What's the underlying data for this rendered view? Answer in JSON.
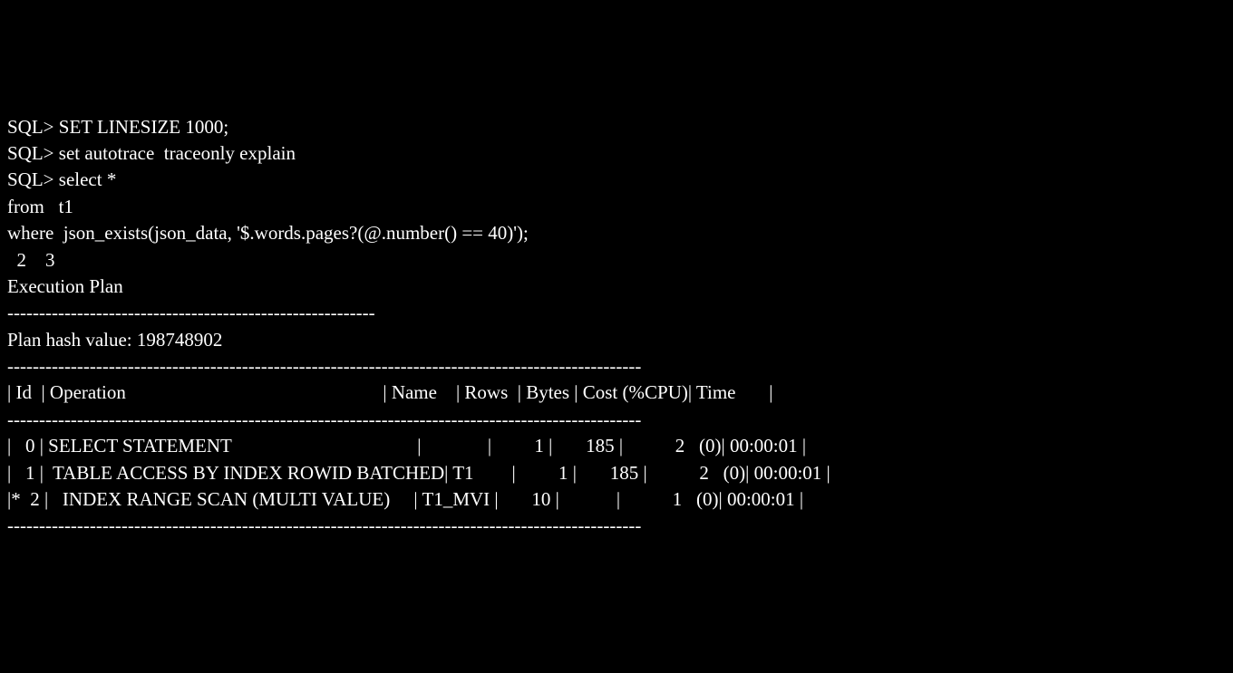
{
  "terminal": {
    "lines": [
      "SQL> SET LINESIZE 1000;",
      "SQL> set autotrace  traceonly explain",
      "SQL> select *",
      "from   t1",
      "where  json_exists(json_data, '$.words.pages?(@.number() == 40)');",
      "  2    3  ",
      "Execution Plan",
      "----------------------------------------------------------",
      "Plan hash value: 198748902",
      "",
      "----------------------------------------------------------------------------------------------------",
      "| Id  | Operation                                                      | Name    | Rows  | Bytes | Cost (%CPU)| Time       |",
      "----------------------------------------------------------------------------------------------------",
      "|   0 | SELECT STATEMENT                                       |              |         1 |       185 |           2   (0)| 00:00:01 |",
      "|   1 |  TABLE ACCESS BY INDEX ROWID BATCHED| T1        |         1 |       185 |           2   (0)| 00:00:01 |",
      "|*  2 |   INDEX RANGE SCAN (MULTI VALUE)     | T1_MVI |       10 |            |           1   (0)| 00:00:01 |",
      "",
      "----------------------------------------------------------------------------------------------------"
    ]
  },
  "execution_plan": {
    "plan_hash_value": "198748902",
    "rows": [
      {
        "id": "0",
        "operation": "SELECT STATEMENT",
        "name": "",
        "rows": "1",
        "bytes": "185",
        "cost_cpu": "2   (0)",
        "time": "00:00:01"
      },
      {
        "id": "1",
        "operation": "TABLE ACCESS BY INDEX ROWID BATCHED",
        "name": "T1",
        "rows": "1",
        "bytes": "185",
        "cost_cpu": "2   (0)",
        "time": "00:00:01"
      },
      {
        "id": "*  2",
        "operation": "INDEX RANGE SCAN (MULTI VALUE)",
        "name": "T1_MVI",
        "rows": "10",
        "bytes": "",
        "cost_cpu": "1   (0)",
        "time": "00:00:01"
      }
    ]
  },
  "sql_commands": {
    "cmd1": "SET LINESIZE 1000;",
    "cmd2": "set autotrace  traceonly explain",
    "cmd3": "select *\nfrom   t1\nwhere  json_exists(json_data, '$.words.pages?(@.number() == 40)');"
  }
}
